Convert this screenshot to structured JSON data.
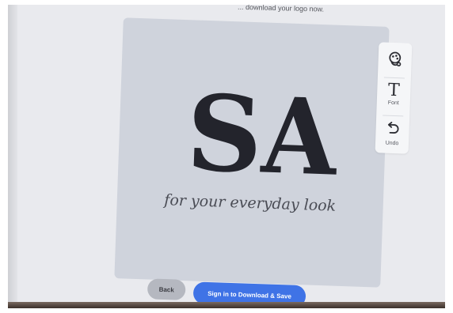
{
  "header": {
    "hint_text": "... download your logo now."
  },
  "logo_preview": {
    "monogram_first": "S",
    "monogram_second": "A",
    "tagline": "for your everyday look",
    "card_color": "#cfd3dc",
    "text_color": "#23242c"
  },
  "toolbar": {
    "items": [
      {
        "icon": "palette-icon",
        "label": ""
      },
      {
        "icon": "font-icon",
        "label": "Font",
        "glyph": "T"
      },
      {
        "icon": "undo-icon",
        "label": "Undo"
      }
    ]
  },
  "actions": {
    "back_label": "Back",
    "signin_label": "Sign in to Download & Save",
    "signin_color": "#3f73e6"
  }
}
